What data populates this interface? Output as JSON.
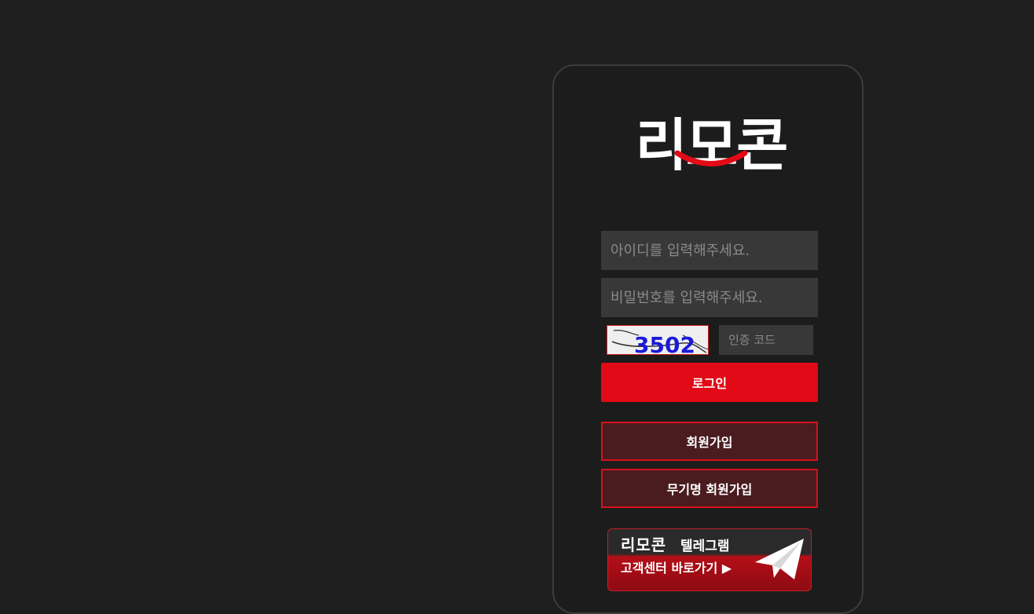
{
  "brand": {
    "name": "리모콘",
    "colors": {
      "accent": "#e20a16",
      "panel_bg": "#1c1c1c",
      "page_bg": "#1e1e1e"
    }
  },
  "login": {
    "username_placeholder": "아이디를 입력해주세요.",
    "password_placeholder": "비밀번호를 입력해주세요.",
    "captcha_text": "3502",
    "captcha_placeholder": "인증 코드",
    "login_label": "로그인",
    "signup_label": "회원가입",
    "anonymous_signup_label": "무기명 회원가입"
  },
  "banner": {
    "logo_text": "리모콘",
    "title": "텔레그램",
    "subtitle": "고객센터 바로가기 ▶",
    "icon": "paper-plane-icon"
  }
}
